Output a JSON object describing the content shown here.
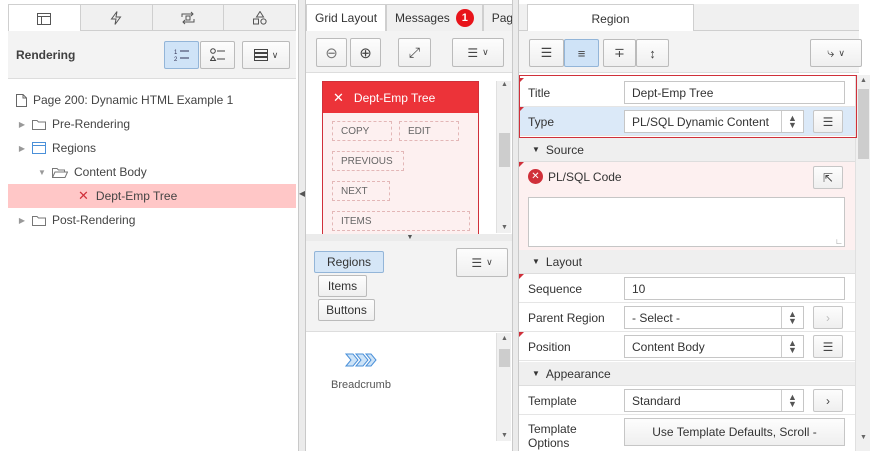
{
  "left": {
    "tabs": [
      "rendering-tab",
      "dynamic-actions-tab",
      "processing-tab",
      "shared-components-tab"
    ],
    "title": "Rendering",
    "tree": [
      {
        "label": "Page 200: Dynamic HTML Example 1",
        "level": 0,
        "icon": "page-icon"
      },
      {
        "label": "Pre-Rendering",
        "level": 1,
        "icon": "folder-icon"
      },
      {
        "label": "Regions",
        "level": 1,
        "icon": "region-icon"
      },
      {
        "label": "Content Body",
        "level": 2,
        "icon": "open-folder-icon"
      },
      {
        "label": "Dept-Emp Tree",
        "level": 3,
        "icon": "error-icon"
      },
      {
        "label": "Post-Rendering",
        "level": 1,
        "icon": "folder-icon"
      }
    ]
  },
  "middle": {
    "tabs": {
      "grid": "Grid Layout",
      "messages": "Messages",
      "messages_count": "1",
      "page": "Pag"
    },
    "region_title": "Dept-Emp Tree",
    "positions": [
      "COPY",
      "EDIT",
      "PREVIOUS",
      "NEXT",
      "ITEMS"
    ],
    "palette_buttons": [
      "Regions",
      "Items",
      "Buttons"
    ],
    "gallery_item": "Breadcrumb"
  },
  "right": {
    "tab": "Region",
    "title_label": "Title",
    "title_value": "Dept-Emp Tree",
    "type_label": "Type",
    "type_value": "PL/SQL Dynamic Content",
    "source_section": "Source",
    "plsql_label": "PL/SQL Code",
    "layout_section": "Layout",
    "sequence_label": "Sequence",
    "sequence_value": "10",
    "parent_label": "Parent Region",
    "parent_value": "- Select -",
    "position_label": "Position",
    "position_value": "Content Body",
    "appearance_section": "Appearance",
    "template_label": "Template",
    "template_value": "Standard",
    "template_options_label": "Template Options",
    "template_options_value": "Use Template Defaults, Scroll -"
  },
  "colors": {
    "accent_red": "#ec3339",
    "selected_row": "#ffc7c7",
    "selected_button": "#cfe3f7"
  }
}
